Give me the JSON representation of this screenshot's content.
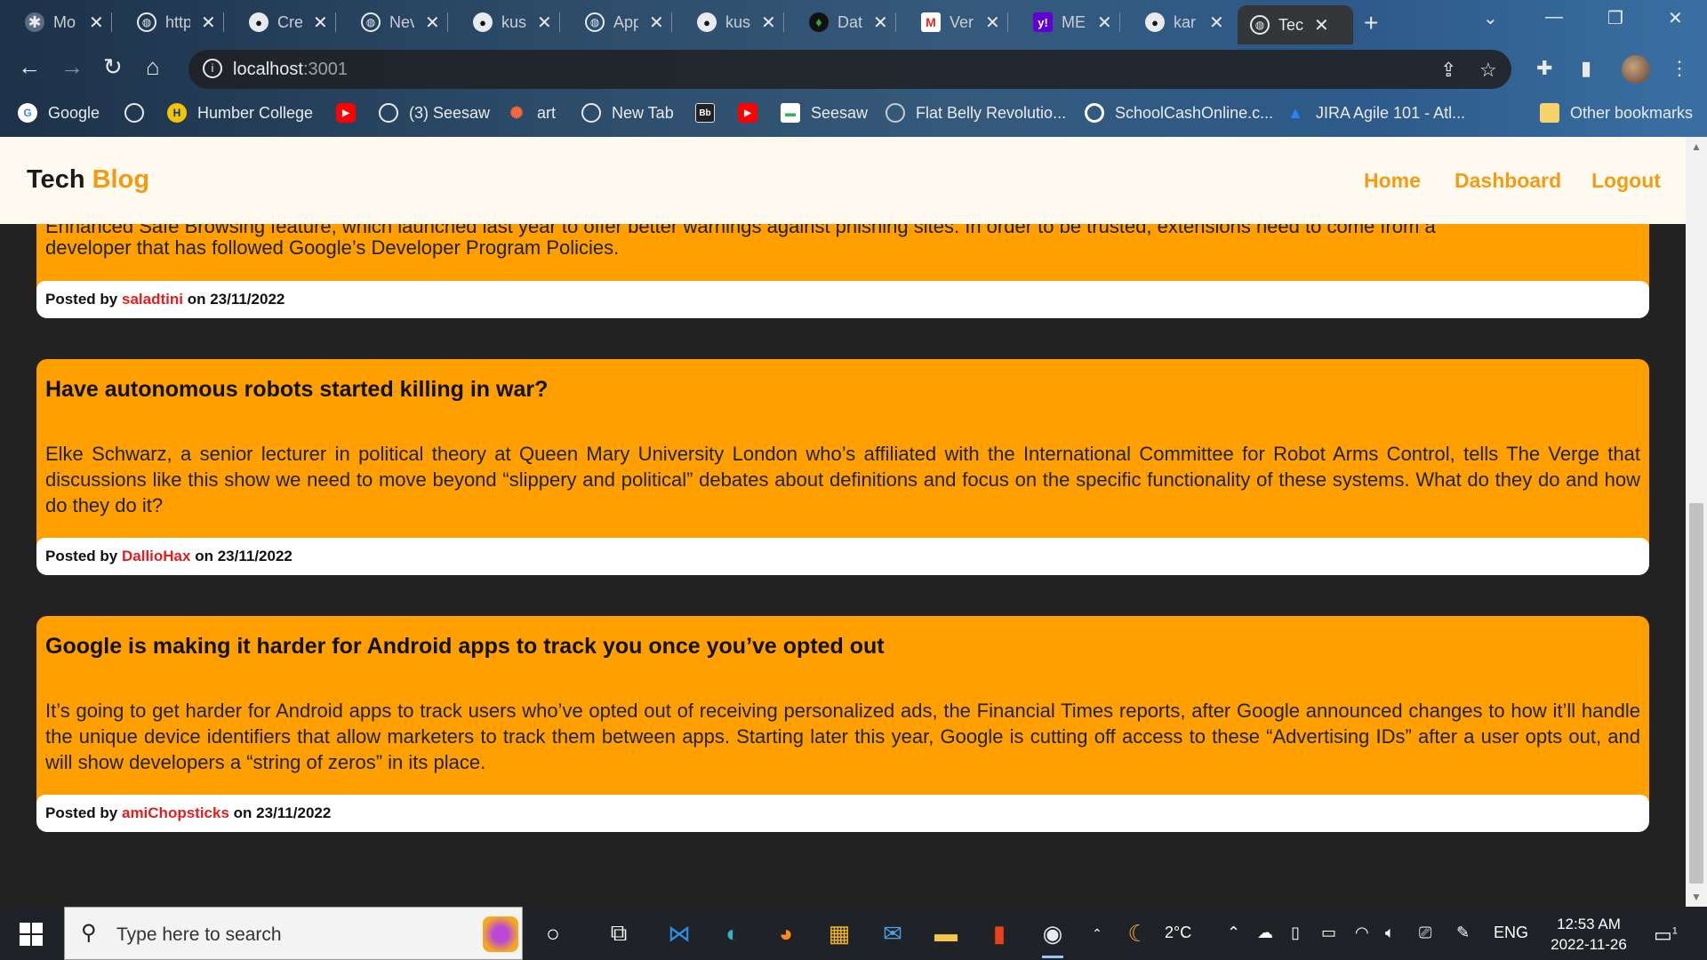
{
  "browser": {
    "tabs": [
      {
        "title": "Mo",
        "icon": "app-icon"
      },
      {
        "title": "http",
        "icon": "globe-icon"
      },
      {
        "title": "Cre",
        "icon": "github-icon"
      },
      {
        "title": "Nev",
        "icon": "globe-icon"
      },
      {
        "title": "kus",
        "icon": "github-icon"
      },
      {
        "title": "App",
        "icon": "globe-icon"
      },
      {
        "title": "kus",
        "icon": "github-icon"
      },
      {
        "title": "Dat",
        "icon": "mongodb-icon"
      },
      {
        "title": "Veri",
        "icon": "gmail-icon"
      },
      {
        "title": "ME",
        "icon": "yahoo-icon"
      },
      {
        "title": "kar",
        "icon": "github-icon"
      },
      {
        "title": "Tecl",
        "icon": "globe-icon"
      }
    ],
    "url_host": "localhost",
    "url_port": ":3001",
    "bookmarks": [
      {
        "label": "Google",
        "icon": "google-icon"
      },
      {
        "label": "",
        "icon": "globe-icon"
      },
      {
        "label": "Humber College",
        "icon": "humber-icon"
      },
      {
        "label": "",
        "icon": "youtube-icon"
      },
      {
        "label": "(3) Seesaw",
        "icon": "globe-icon"
      },
      {
        "label": "art",
        "icon": "art-icon"
      },
      {
        "label": "New Tab",
        "icon": "globe-icon"
      },
      {
        "label": "",
        "icon": "blackboard-icon"
      },
      {
        "label": "",
        "icon": "youtube-icon"
      },
      {
        "label": "Seesaw",
        "icon": "seesaw-icon"
      },
      {
        "label": "Flat Belly Revolutio...",
        "icon": "globe-icon"
      },
      {
        "label": "SchoolCashOnline.c...",
        "icon": "schoolcash-icon"
      },
      {
        "label": "JIRA Agile 101 - Atl...",
        "icon": "jira-icon"
      }
    ],
    "other_bookmarks": "Other bookmarks"
  },
  "site": {
    "brand_main": "Tech",
    "brand_accent": "Blog",
    "nav": [
      "Home",
      "Dashboard",
      "Logout"
    ]
  },
  "posts": [
    {
      "title": "",
      "body_partial_top": "Enhanced Safe Browsing feature, which launched last year to offer better warnings against phishing sites. In order to be trusted, extensions need to come from a",
      "body": "developer that has followed Google’s Developer Program Policies.",
      "posted_by_label": "Posted by",
      "author": "saladtini",
      "on_label": "on",
      "date": "23/11/2022"
    },
    {
      "title": "Have autonomous robots started killing in war?",
      "body": "Elke Schwarz, a senior lecturer in political theory at Queen Mary University London who’s affiliated with the International Committee for Robot Arms Control, tells The Verge that discussions like this show we need to move beyond “slippery and political” debates about definitions and focus on the specific functionality of these systems. What do they do and how do they do it?",
      "posted_by_label": "Posted by",
      "author": "DallioHax",
      "on_label": "on",
      "date": "23/11/2022"
    },
    {
      "title": "Google is making it harder for Android apps to track you once you’ve opted out",
      "body": "It’s going to get harder for Android apps to track users who’ve opted out of receiving personalized ads, the Financial Times reports, after Google announced changes to how it’ll handle the unique device identifiers that allow marketers to track them between apps. Starting later this year, Google is cutting off access to these “Advertising IDs” after a user opts out, and will show developers a “string of zeros” in its place.",
      "posted_by_label": "Posted by",
      "author": "amiChopsticks",
      "on_label": "on",
      "date": "23/11/2022"
    }
  ],
  "taskbar": {
    "search_placeholder": "Type here to search",
    "weather": "2°C",
    "language": "ENG",
    "time": "12:53 AM",
    "date": "2022-11-26",
    "notification_count": "1"
  },
  "colors": {
    "accent": "#f39c12",
    "card": "#ff9f00",
    "author": "#e02020",
    "page_bg": "#222222"
  }
}
